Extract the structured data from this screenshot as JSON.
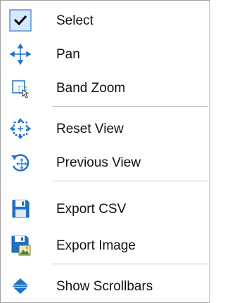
{
  "menu": {
    "items": [
      {
        "label": "Select",
        "icon": "checkmark-icon",
        "checked": true
      },
      {
        "label": "Pan",
        "icon": "pan-arrows-icon"
      },
      {
        "label": "Band Zoom",
        "icon": "band-zoom-icon"
      },
      {
        "label": "Reset View",
        "icon": "reset-view-icon"
      },
      {
        "label": "Previous View",
        "icon": "previous-view-icon"
      },
      {
        "label": "Export CSV",
        "icon": "floppy-disk-icon"
      },
      {
        "label": "Export Image",
        "icon": "floppy-image-icon"
      },
      {
        "label": "Show Scrollbars",
        "icon": "scrollbar-arrows-icon"
      }
    ]
  },
  "colors": {
    "border": "#a0a0a0",
    "separator": "#c8c8c8",
    "checked_bg": "#d6e8ff",
    "checked_border": "#5a8fd6",
    "icon_blue": "#1e72c8",
    "text": "#111111"
  }
}
